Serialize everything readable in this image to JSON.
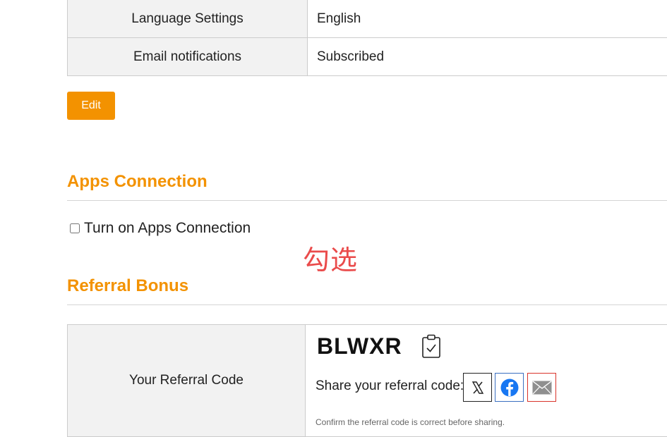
{
  "settings_table": {
    "rows": [
      {
        "label": "Language Settings",
        "value": "English"
      },
      {
        "label": "Email notifications",
        "value": "Subscribed"
      }
    ]
  },
  "edit_button": {
    "label": "Edit"
  },
  "apps_connection": {
    "heading": "Apps Connection",
    "checkbox_label": "Turn on Apps Connection",
    "checked": false
  },
  "annotation": {
    "text": "勾选"
  },
  "referral": {
    "heading": "Referral Bonus",
    "code_label": "Your Referral Code",
    "code": "BLWXR",
    "share_label": "Share your referral code:",
    "share_buttons": [
      "x-icon",
      "facebook-icon",
      "mail-icon"
    ],
    "confirm_note": "Confirm the referral code is correct before sharing."
  },
  "colors": {
    "accent": "#f39200",
    "annotation": "#ea4b4b",
    "facebook": "#1877f2",
    "mail_border": "#d9342b"
  }
}
